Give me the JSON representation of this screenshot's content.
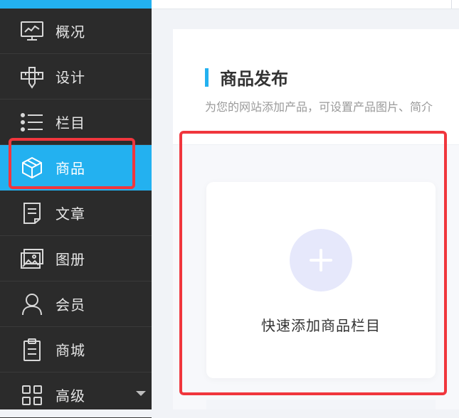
{
  "sidebar": {
    "items": [
      {
        "label": "概况",
        "icon": "chart-monitor-icon"
      },
      {
        "label": "设计",
        "icon": "ruler-pencil-icon"
      },
      {
        "label": "栏目",
        "icon": "list-icon"
      },
      {
        "label": "商品",
        "icon": "cube-icon",
        "active": true
      },
      {
        "label": "文章",
        "icon": "document-icon"
      },
      {
        "label": "图册",
        "icon": "image-gallery-icon"
      },
      {
        "label": "会员",
        "icon": "user-icon"
      },
      {
        "label": "商城",
        "icon": "clipboard-icon"
      },
      {
        "label": "高级",
        "icon": "grid-icon",
        "has_dropdown": true
      }
    ]
  },
  "main": {
    "title": "商品发布",
    "subtitle": "为您的网站添加产品，可设置产品图片、简介",
    "add_card": {
      "label": "快速添加商品栏目",
      "icon": "plus-icon"
    }
  },
  "colors": {
    "sidebar_bg": "#2b2b2b",
    "accent": "#23b1f0",
    "highlight_box": "#f0363d",
    "plus_circle": "#e6e8fb"
  }
}
